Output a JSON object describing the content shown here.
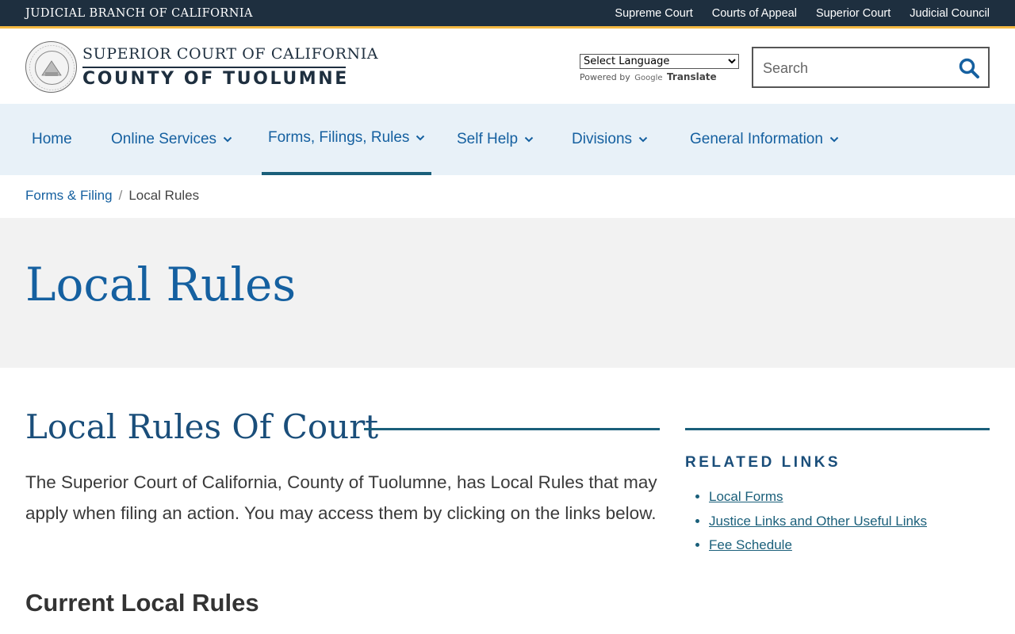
{
  "topbar": {
    "branch": "JUDICIAL BRANCH OF CALIFORNIA",
    "links": [
      "Supreme Court",
      "Courts of Appeal",
      "Superior Court",
      "Judicial Council"
    ]
  },
  "header": {
    "line1": "SUPERIOR COURT OF CALIFORNIA",
    "line2": "COUNTY OF TUOLUMNE",
    "language_select": "Select Language",
    "powered_by": "Powered by",
    "google": "Google",
    "translate": "Translate",
    "search_placeholder": "Search"
  },
  "nav": {
    "items": [
      {
        "label": "Home"
      },
      {
        "label": "Online Services"
      },
      {
        "label": "Forms, Filings, Rules"
      },
      {
        "label": "Self Help"
      },
      {
        "label": "Divisions"
      },
      {
        "label": "General Information"
      }
    ]
  },
  "breadcrumb": {
    "parent": "Forms & Filing",
    "separator": "/",
    "current": "Local Rules"
  },
  "page": {
    "title": "Local Rules"
  },
  "main": {
    "heading": "Local Rules Of Court",
    "paragraph": "The Superior Court of California, County of Tuolumne, has Local Rules that may apply when filing an action. You may access them by clicking on the links below.",
    "subheading": "Current Local Rules"
  },
  "sidebar": {
    "heading": "RELATED LINKS",
    "links": [
      "Local Forms",
      "Justice Links and Other Useful Links",
      "Fee Schedule"
    ]
  },
  "colors": {
    "topbar": "#1e2f3f",
    "accent_gold": "#f4b942",
    "link_blue": "#1560a0",
    "teal": "#1a5f7a"
  }
}
